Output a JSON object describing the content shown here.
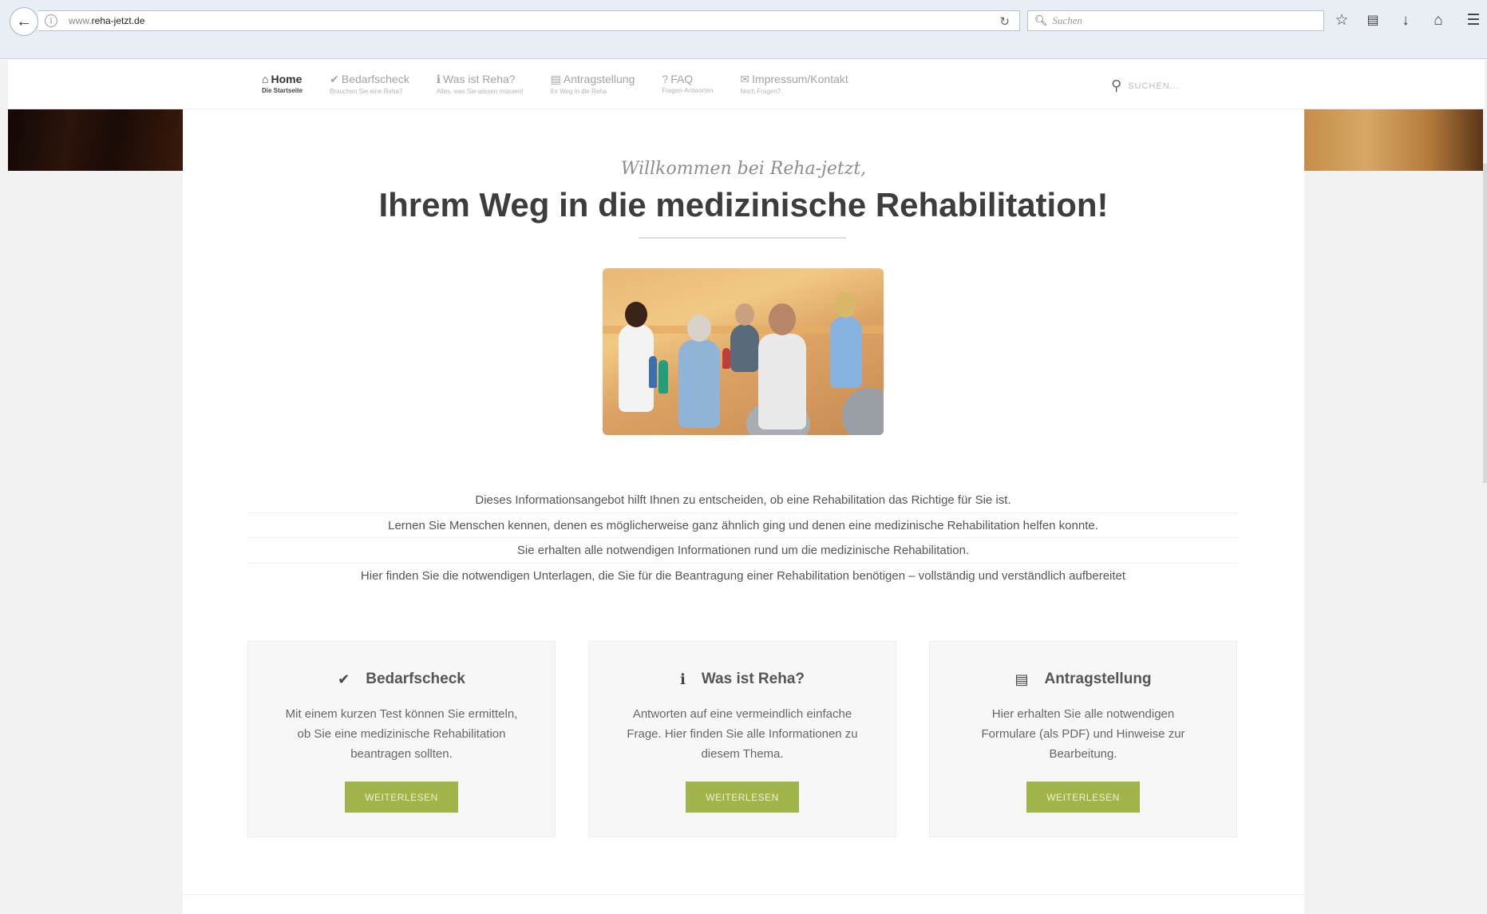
{
  "browser": {
    "url_prefix": "www.",
    "url_domain": "reha-jetzt.de",
    "search_placeholder": "Suchen",
    "icons": [
      "back-icon",
      "info-icon",
      "reload-icon",
      "search-icon",
      "bookmark-star-icon",
      "library-icon",
      "download-icon",
      "home-icon",
      "menu-icon"
    ]
  },
  "nav": {
    "items": [
      {
        "icon": "⌂",
        "label": "Home",
        "sub": "Die Startseite"
      },
      {
        "icon": "✔",
        "label": "Bedarfscheck",
        "sub": "Brauchen Sie eine Reha?"
      },
      {
        "icon": "ℹ",
        "label": "Was ist Reha?",
        "sub": "Alles, was Sie wissen müssen!"
      },
      {
        "icon": "▤",
        "label": "Antragstellung",
        "sub": "Ihr Weg in die Reha"
      },
      {
        "icon": "?",
        "label": "FAQ",
        "sub": "Fragen-Antworten"
      },
      {
        "icon": "✉",
        "label": "Impressum/Kontakt",
        "sub": "Noch Fragen?"
      }
    ],
    "search_placeholder": "SUCHEN..."
  },
  "hero": {
    "welcome": "Willkommen bei Reha-jetzt,",
    "headline": "Ihrem Weg in die medizinische Rehabilitation!"
  },
  "info_lines": [
    "Dieses Informationsangebot hilft Ihnen zu entscheiden, ob eine Rehabilitation das Richtige für Sie ist.",
    "Lernen Sie Menschen kennen, denen es möglicherweise ganz ähnlich ging und denen eine medizinische Rehabilitation helfen konnte.",
    "Sie erhalten alle notwendigen Informationen rund um die medizinische Rehabilitation.",
    "Hier finden Sie die notwendigen Unterlagen, die Sie für die Beantragung einer Rehabilitation benötigen – vollständig und verständlich aufbereitet"
  ],
  "cards": [
    {
      "icon": "✔",
      "title": "Bedarfscheck",
      "text": "Mit einem kurzen Test können Sie ermitteln, ob Sie eine medizinische Rehabilitation beantragen sollten.",
      "button": "WEITERLESEN"
    },
    {
      "icon": "ℹ",
      "title": "Was ist Reha?",
      "text": "Antworten auf eine vermeindlich einfache Frage. Hier finden Sie alle Informationen zu diesem Thema.",
      "button": "WEITERLESEN"
    },
    {
      "icon": "▤",
      "title": "Antragstellung",
      "text": "Hier erhalten Sie alle notwendigen Formulare (als PDF) und Hinweise zur Bearbeitung.",
      "button": "WEITERLESEN"
    }
  ],
  "colors": {
    "accent": "#9fb54a",
    "heading": "#3d3d3d",
    "chrome": "#e9eef5"
  }
}
